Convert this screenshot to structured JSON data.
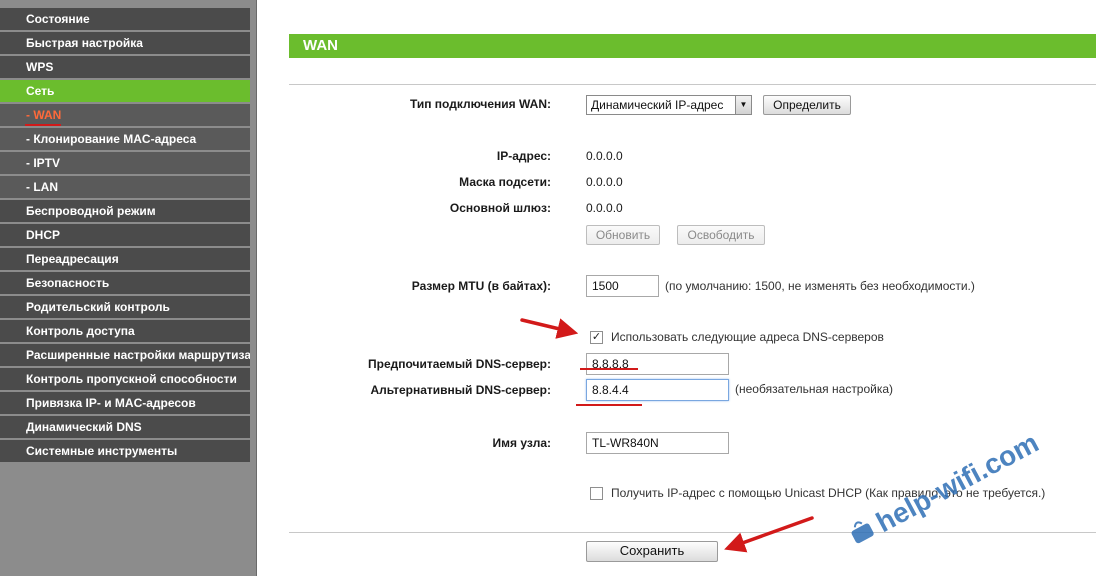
{
  "sidebar": {
    "items": [
      {
        "label": "Состояние",
        "kind": "top"
      },
      {
        "label": "Быстрая настройка",
        "kind": "top"
      },
      {
        "label": "WPS",
        "kind": "top"
      },
      {
        "label": "Сеть",
        "kind": "active"
      },
      {
        "label": "- WAN",
        "kind": "current"
      },
      {
        "label": "- Клонирование MAC-адреса",
        "kind": "sub"
      },
      {
        "label": "- IPTV",
        "kind": "sub"
      },
      {
        "label": "- LAN",
        "kind": "sub"
      },
      {
        "label": "Беспроводной режим",
        "kind": "top"
      },
      {
        "label": "DHCP",
        "kind": "top"
      },
      {
        "label": "Переадресация",
        "kind": "top"
      },
      {
        "label": "Безопасность",
        "kind": "top"
      },
      {
        "label": "Родительский контроль",
        "kind": "top"
      },
      {
        "label": "Контроль доступа",
        "kind": "top"
      },
      {
        "label": "Расширенные настройки маршрутизации",
        "kind": "top"
      },
      {
        "label": "Контроль пропускной способности",
        "kind": "top"
      },
      {
        "label": "Привязка IP- и MAC-адресов",
        "kind": "top"
      },
      {
        "label": "Динамический DNS",
        "kind": "top"
      },
      {
        "label": "Системные инструменты",
        "kind": "top"
      }
    ]
  },
  "page": {
    "title": "WAN",
    "connection_type_label": "Тип подключения WAN:",
    "connection_type_value": "Динамический IP-адрес",
    "detect_button": "Определить",
    "ip_label": "IP-адрес:",
    "ip_value": "0.0.0.0",
    "mask_label": "Маска подсети:",
    "mask_value": "0.0.0.0",
    "gateway_label": "Основной шлюз:",
    "gateway_value": "0.0.0.0",
    "renew_button": "Обновить",
    "release_button": "Освободить",
    "mtu_label": "Размер MTU (в байтах):",
    "mtu_value": "1500",
    "mtu_note": "(по умолчанию: 1500, не изменять без необходимости.)",
    "use_dns_label": "Использовать следующие адреса DNS-серверов",
    "use_dns_checked": true,
    "primary_dns_label": "Предпочитаемый DNS-сервер:",
    "primary_dns_value": "8.8.8.8",
    "secondary_dns_label": "Альтернативный DNS-сервер:",
    "secondary_dns_value": "8.8.4.4",
    "secondary_dns_note": "(необязательная настройка)",
    "hostname_label": "Имя узла:",
    "hostname_value": "TL-WR840N",
    "unicast_label": "Получить IP-адрес с помощью Unicast DHCP (Как правило, это не требуется.)",
    "unicast_checked": false,
    "save_button": "Сохранить"
  },
  "watermark": {
    "text": "help-wifi.com"
  },
  "colors": {
    "accent_green": "#6bbd2d",
    "menu_dark": "#4b4b4b",
    "annotation_red": "#d21a1a"
  }
}
